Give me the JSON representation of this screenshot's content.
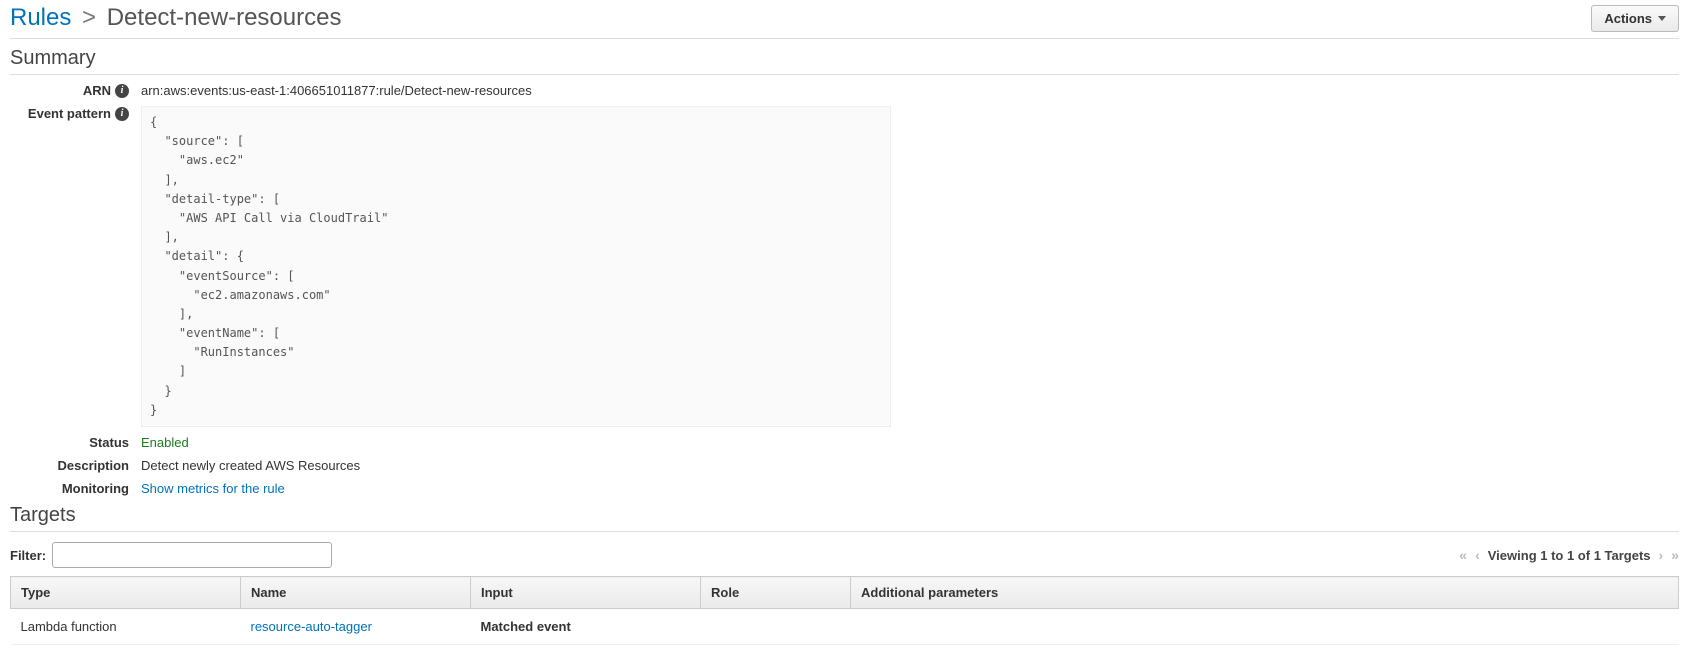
{
  "breadcrumb": {
    "root": "Rules",
    "sep": ">",
    "current": "Detect-new-resources"
  },
  "actions_label": "Actions",
  "summary": {
    "heading": "Summary",
    "labels": {
      "arn": "ARN",
      "event_pattern": "Event pattern",
      "status": "Status",
      "description": "Description",
      "monitoring": "Monitoring"
    },
    "arn": "arn:aws:events:us-east-1:406651011877:rule/Detect-new-resources",
    "event_pattern": "{\n  \"source\": [\n    \"aws.ec2\"\n  ],\n  \"detail-type\": [\n    \"AWS API Call via CloudTrail\"\n  ],\n  \"detail\": {\n    \"eventSource\": [\n      \"ec2.amazonaws.com\"\n    ],\n    \"eventName\": [\n      \"RunInstances\"\n    ]\n  }\n}",
    "status": "Enabled",
    "description": "Detect newly created AWS Resources",
    "monitoring_link": "Show metrics for the rule"
  },
  "targets": {
    "heading": "Targets",
    "filter_label": "Filter:",
    "filter_value": "",
    "pager_text": "Viewing 1 to 1 of 1 Targets",
    "columns": {
      "type": "Type",
      "name": "Name",
      "input": "Input",
      "role": "Role",
      "additional": "Additional parameters"
    },
    "rows": [
      {
        "type": "Lambda function",
        "name": "resource-auto-tagger",
        "input": "Matched event",
        "role": "",
        "additional": ""
      }
    ]
  }
}
